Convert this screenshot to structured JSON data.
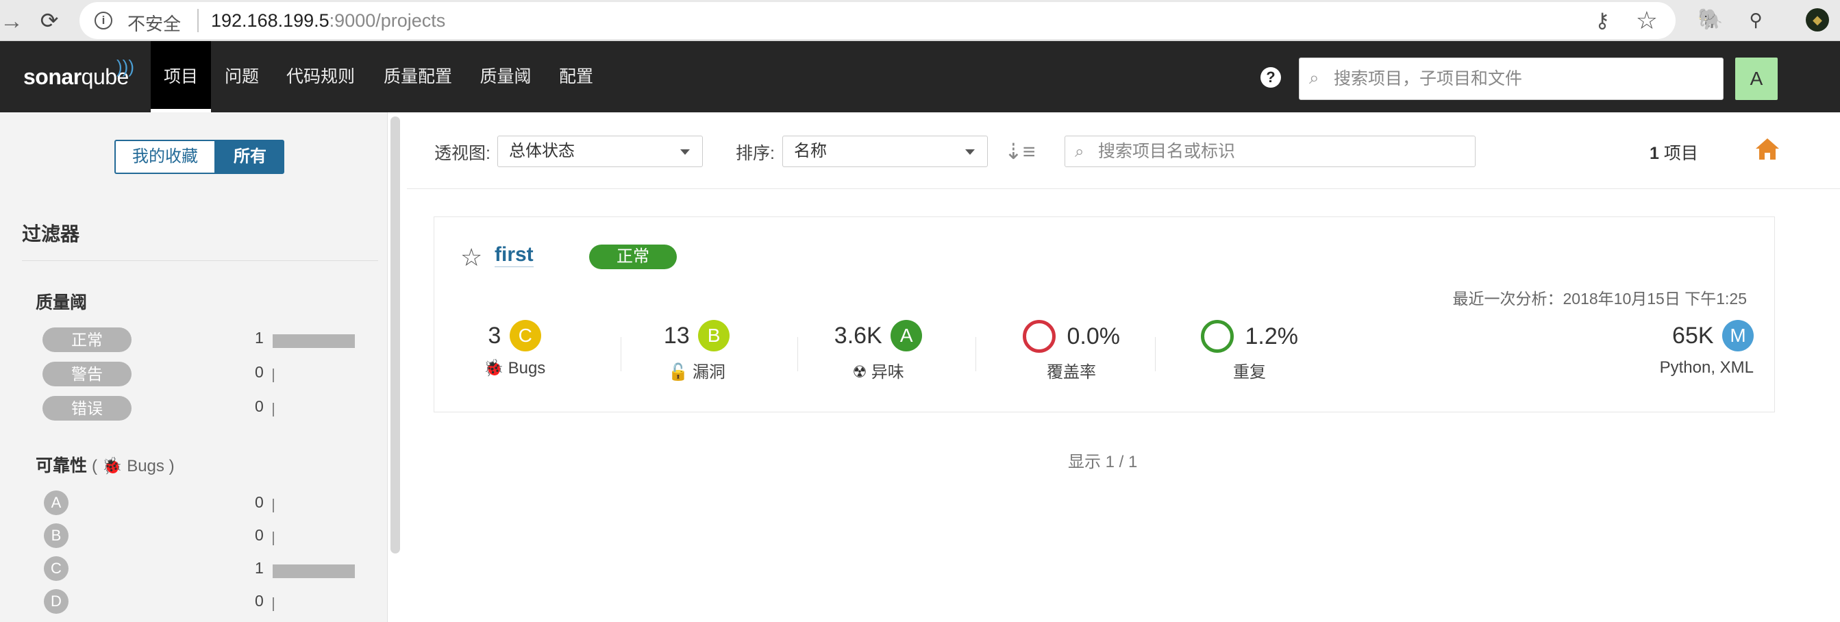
{
  "browser": {
    "insecure_label": "不安全",
    "url_host": "192.168.199.5",
    "url_rest": ":9000/projects"
  },
  "nav": {
    "logo_text": "sonarqube",
    "items": [
      {
        "label": "项目",
        "active": true
      },
      {
        "label": "问题"
      },
      {
        "label": "代码规则"
      },
      {
        "label": "质量配置"
      },
      {
        "label": "质量阈"
      },
      {
        "label": "配置"
      }
    ],
    "search_placeholder": "搜索项目，子项目和文件",
    "user_initial": "A"
  },
  "sidebar": {
    "toggle_favorites": "我的收藏",
    "toggle_all": "所有",
    "filters_title": "过滤器",
    "quality_gate": {
      "title": "质量阈",
      "rows": [
        {
          "label": "正常",
          "count": "1",
          "fraction": 1
        },
        {
          "label": "警告",
          "count": "0",
          "fraction": 0
        },
        {
          "label": "错误",
          "count": "0",
          "fraction": 0
        }
      ]
    },
    "reliability": {
      "title": "可靠性",
      "subtitle": "Bugs",
      "rows": [
        {
          "label": "A",
          "count": "0",
          "fraction": 0
        },
        {
          "label": "B",
          "count": "0",
          "fraction": 0
        },
        {
          "label": "C",
          "count": "1",
          "fraction": 1
        },
        {
          "label": "D",
          "count": "0",
          "fraction": 0
        }
      ]
    }
  },
  "toolbar": {
    "perspective_label": "透视图:",
    "perspective_value": "总体状态",
    "sort_label": "排序:",
    "sort_value": "名称",
    "search_placeholder": "搜索项目名或标识",
    "project_count": "1",
    "project_count_unit": "项目"
  },
  "project": {
    "name": "first",
    "quality_gate_status": "正常",
    "last_analysis": "最近一次分析：2018年10月15日 下午1:25",
    "bugs": {
      "value": "3",
      "grade": "C",
      "label": "Bugs"
    },
    "vulnerabilities": {
      "value": "13",
      "grade": "B",
      "label": "漏洞"
    },
    "code_smells": {
      "value": "3.6K",
      "grade": "A",
      "label": "异味"
    },
    "coverage": {
      "value": "0.0%",
      "label": "覆盖率"
    },
    "duplications": {
      "value": "1.2%",
      "label": "重复"
    },
    "size": {
      "value": "65K",
      "grade": "M",
      "label": "Python, XML"
    }
  },
  "pager": {
    "text": "显示 1 / 1"
  },
  "colors": {
    "grade_A": "#3c9a2e",
    "grade_B": "#b0d513",
    "grade_C": "#eabe06",
    "size_M": "#4b9fd5",
    "coverage_ring": "#d4333f",
    "duplication_ring": "#3c9a2e",
    "brand_blue": "#236a97",
    "home_orange": "#e6892b"
  }
}
